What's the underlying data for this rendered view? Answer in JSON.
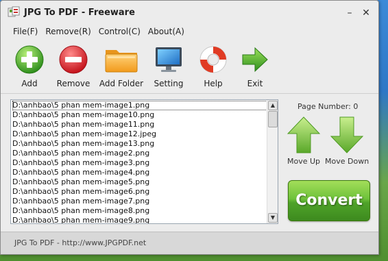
{
  "window": {
    "title": "JPG To PDF - Freeware",
    "minimize": "–",
    "close": "✕"
  },
  "menu": [
    "File(F)",
    "Remove(R)",
    "Control(C)",
    "About(A)"
  ],
  "toolbar": [
    {
      "label": "Add",
      "icon": "add-icon"
    },
    {
      "label": "Remove",
      "icon": "remove-icon"
    },
    {
      "label": "Add Folder",
      "icon": "folder-icon"
    },
    {
      "label": "Setting",
      "icon": "monitor-icon"
    },
    {
      "label": "Help",
      "icon": "lifebuoy-icon"
    },
    {
      "label": "Exit",
      "icon": "exit-arrow-icon"
    }
  ],
  "files": [
    "D:\\anhbao\\5 phan mem-image1.png",
    "D:\\anhbao\\5 phan mem-image10.png",
    "D:\\anhbao\\5 phan mem-image11.png",
    "D:\\anhbao\\5 phan mem-image12.jpeg",
    "D:\\anhbao\\5 phan mem-image13.png",
    "D:\\anhbao\\5 phan mem-image2.png",
    "D:\\anhbao\\5 phan mem-image3.png",
    "D:\\anhbao\\5 phan mem-image4.png",
    "D:\\anhbao\\5 phan mem-image5.png",
    "D:\\anhbao\\5 phan mem-image6.png",
    "D:\\anhbao\\5 phan mem-image7.png",
    "D:\\anhbao\\5 phan mem-image8.png",
    "D:\\anhbao\\5 phan mem-image9.png"
  ],
  "side": {
    "page_number": "Page Number: 0",
    "move_up": "Move Up",
    "move_down": "Move Down",
    "convert": "Convert"
  },
  "footer": "JPG To PDF - http://www.JPGPDF.net",
  "colors": {
    "accent_green": "#4fa32a",
    "arrow_green": "#7cc33a",
    "remove_red": "#e0232b",
    "folder_orange": "#f5a623"
  }
}
